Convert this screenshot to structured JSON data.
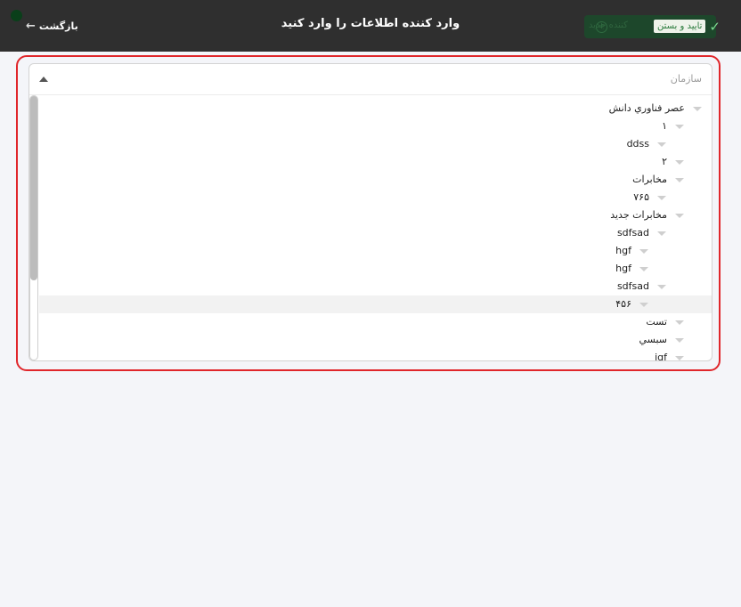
{
  "header": {
    "title": "وارد کننده اطلاعات را وارد کنید",
    "back_label": "بازگشت",
    "back_arrow": "←",
    "new_button_label": "کننده جدید",
    "new_button_icon": "+",
    "confirm_label": "تایید و بستن",
    "confirm_icon": "✓"
  },
  "field": {
    "placeholder": "سازمان"
  },
  "tree": [
    {
      "label": "عصر فناوري دانش"
    },
    {
      "label": "۱"
    },
    {
      "label": "ddss"
    },
    {
      "label": "۲"
    },
    {
      "label": "مخابرات"
    },
    {
      "label": "۷۶۵"
    },
    {
      "label": "مخابرات جدید"
    },
    {
      "label": "sdfsad"
    },
    {
      "label": "hgf"
    },
    {
      "label": "hgf"
    },
    {
      "label": "sdfsad"
    },
    {
      "label": "۴۵۶"
    },
    {
      "label": "تست"
    },
    {
      "label": "سبسي"
    },
    {
      "label": "jgf"
    }
  ]
}
